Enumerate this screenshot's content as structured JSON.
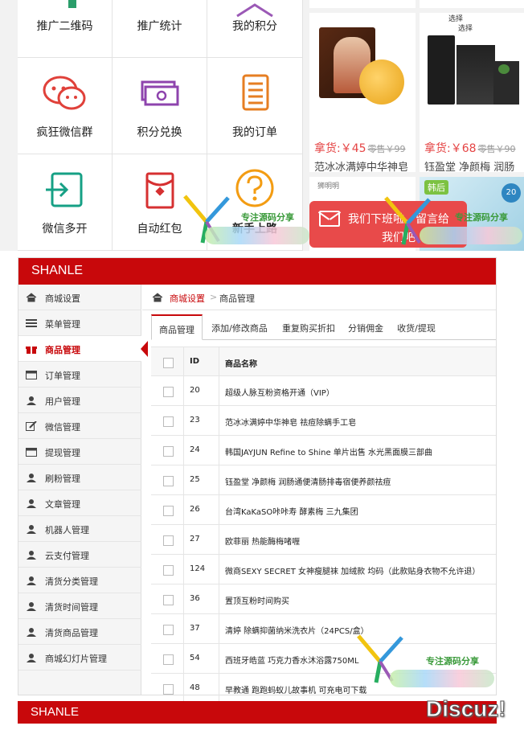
{
  "mobile": {
    "grid": [
      {
        "label": "推广二维码",
        "icon": "qr-code-icon"
      },
      {
        "label": "推广统计",
        "icon": "tree-chart-icon"
      },
      {
        "label": "我的积分",
        "icon": "hanger-icon"
      },
      {
        "label": "疯狂微信群",
        "icon": "wechat-icon"
      },
      {
        "label": "积分兑换",
        "icon": "cash-icon"
      },
      {
        "label": "我的订单",
        "icon": "order-list-icon"
      },
      {
        "label": "微信多开",
        "icon": "login-icon"
      },
      {
        "label": "自动红包",
        "icon": "red-envelope-icon"
      },
      {
        "label": "新手上路",
        "icon": "question-icon"
      }
    ],
    "products": [
      {
        "price_label": "拿货:￥45",
        "old_price": "零售￥99",
        "title": "范冰冰满婷中华神皂"
      },
      {
        "price_label": "拿货:￥68",
        "old_price": "零售￥90",
        "title": "钰盈堂 净颜梅 润肠"
      }
    ],
    "product2_banner": [
      "选择",
      "选择"
    ],
    "product3_brand": "狮明明",
    "product4_brand": "韩后",
    "product4_badge": "20",
    "message_box": {
      "line1": "我们下班啦，留言给",
      "line2": "我们吧"
    },
    "watermark": "专注源码分享"
  },
  "admin": {
    "brand": "SHANLE",
    "sidebar": [
      {
        "label": "商城设置",
        "icon": "home-icon"
      },
      {
        "label": "菜单管理",
        "icon": "list-icon"
      },
      {
        "label": "商品管理",
        "icon": "gift-icon",
        "active": true
      },
      {
        "label": "订单管理",
        "icon": "calendar-icon"
      },
      {
        "label": "用户管理",
        "icon": "users-icon"
      },
      {
        "label": "微信管理",
        "icon": "edit-icon"
      },
      {
        "label": "提现管理",
        "icon": "calendar-icon"
      },
      {
        "label": "刷粉管理",
        "icon": "users-icon"
      },
      {
        "label": "文章管理",
        "icon": "users-icon"
      },
      {
        "label": "机器人管理",
        "icon": "users-icon"
      },
      {
        "label": "云支付管理",
        "icon": "users-icon"
      },
      {
        "label": "清货分类管理",
        "icon": "users-icon"
      },
      {
        "label": "清货时间管理",
        "icon": "users-icon"
      },
      {
        "label": "清货商品管理",
        "icon": "users-icon"
      },
      {
        "label": "商城幻灯片管理",
        "icon": "users-icon"
      }
    ],
    "breadcrumb": {
      "parent": "商城设置",
      "separator": ">",
      "current": "商品管理"
    },
    "tabs": [
      "商品管理",
      "添加/修改商品",
      "重复购买折扣",
      "分销佣金",
      "收货/提现"
    ],
    "table": {
      "headers": {
        "id": "ID",
        "name": "商品名称"
      },
      "rows": [
        {
          "id": "20",
          "name": "超级人脉互粉资格开通（VIP）"
        },
        {
          "id": "23",
          "name": "范冰冰满婷中华神皂 祛痘除螨手工皂"
        },
        {
          "id": "24",
          "name": "韩国JAYJUN Refine to Shine 单片出售 水光黑面膜三部曲"
        },
        {
          "id": "25",
          "name": "钰盈堂 净颜梅 润肠通便清肠排毒宿便养颜祛痘"
        },
        {
          "id": "26",
          "name": "台湾KaKaSO咔咔寿 酵素梅 三九集团"
        },
        {
          "id": "27",
          "name": "欧菲丽 热能酶梅啫喱"
        },
        {
          "id": "124",
          "name": "微商SEXY SECRET 女神瘦腿袜 加绒款 均码（此款贴身衣物不允许退）"
        },
        {
          "id": "36",
          "name": "置顶互粉时间购买"
        },
        {
          "id": "37",
          "name": "清婷 除螨抑菌纳米洗衣片（24PCS/盒）"
        },
        {
          "id": "54",
          "name": "西班牙皓蓝 巧克力香水沐浴露750ML"
        },
        {
          "id": "48",
          "name": "早教通 跑跑蚂蚁儿故事机 可充电可下载"
        }
      ]
    },
    "watermark": "专注源码分享"
  },
  "bottom": {
    "brand": "SHANLE",
    "forum_logo": "Discuz!"
  },
  "colors": {
    "brand_red": "#c8080b",
    "price_red": "#e54444"
  }
}
